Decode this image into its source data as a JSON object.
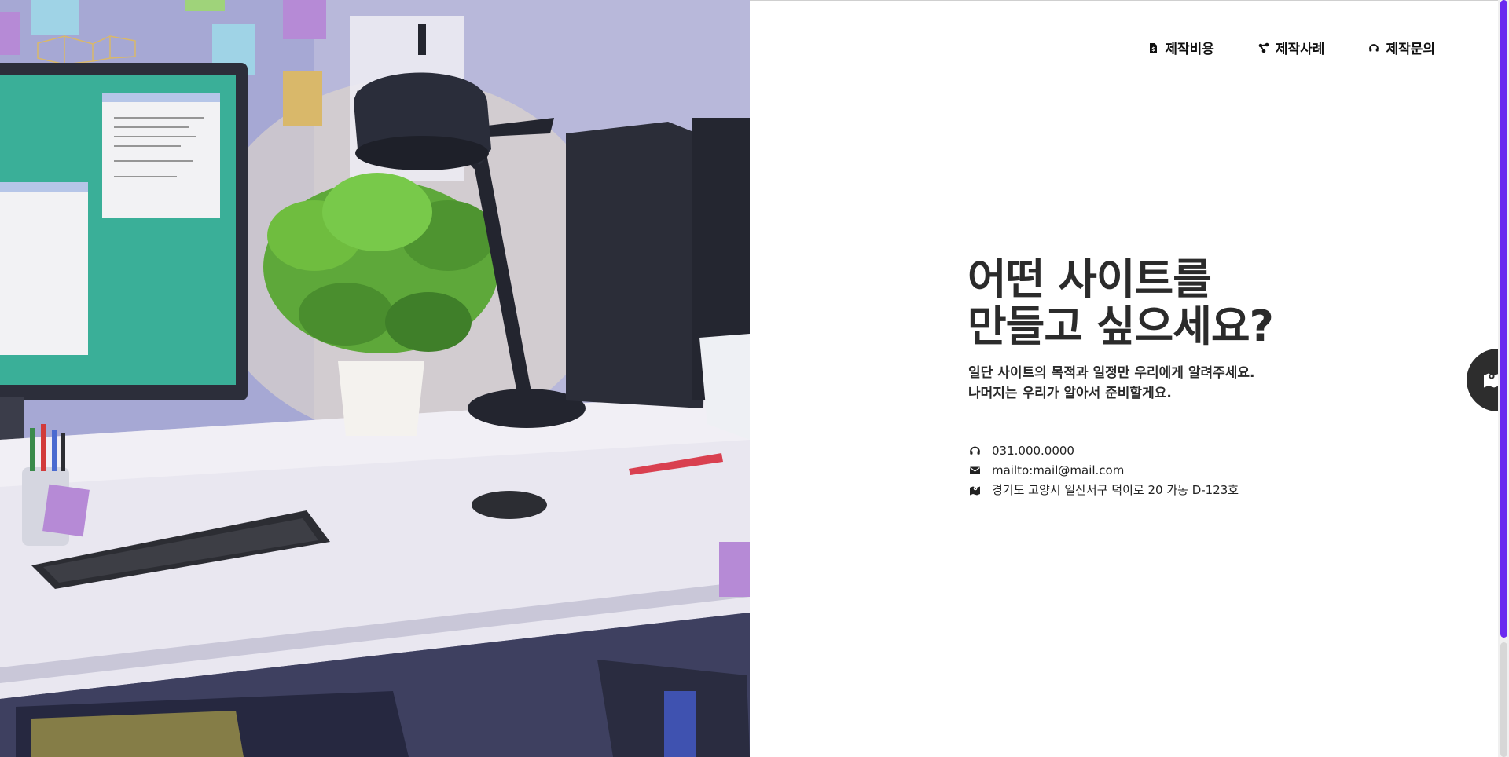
{
  "nav": {
    "items": [
      {
        "label": "제작비용",
        "icon": "price-tag-icon"
      },
      {
        "label": "제작사례",
        "icon": "share-nodes-icon"
      },
      {
        "label": "제작문의",
        "icon": "headset-icon"
      }
    ]
  },
  "hero": {
    "headline_line1": "어떤 사이트를",
    "headline_line2": "만들고 싶으세요?",
    "sub_line1": "일단 사이트의 목적과 일정만 우리에게 알려주세요.",
    "sub_line2": "나머지는 우리가 알아서 준비할게요."
  },
  "contact": {
    "phone": "031.000.0000",
    "email": "mailto:mail@mail.com",
    "address": "경기도 고양시 일산서구 덕이로 20 가동 D-123호"
  },
  "colors": {
    "accent": "#6a2bf0",
    "text": "#2b2b2b",
    "fab": "#2d2d2d"
  }
}
